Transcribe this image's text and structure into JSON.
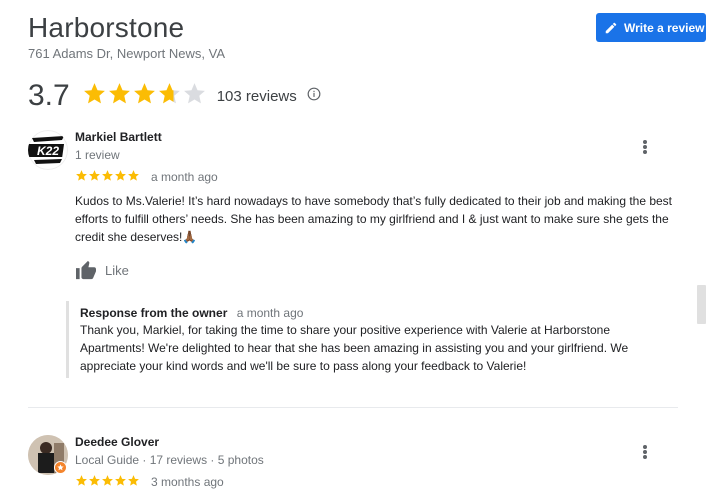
{
  "place": {
    "name": "Harborstone",
    "address": "761 Adams Dr, Newport News, VA",
    "rating": "3.7",
    "rating_value": 3.7,
    "review_count": "103 reviews"
  },
  "actions": {
    "write_review": "Write a review"
  },
  "colors": {
    "accent": "#1a73e8",
    "star": "#fbbc04",
    "star_empty": "#dadce0"
  },
  "reviews": [
    {
      "author": "Markiel Bartlett",
      "meta": "1 review",
      "avatar_text": "K22",
      "stars": 5,
      "when": "a month ago",
      "text": "Kudos to Ms.Valerie! It’s hard nowadays to have somebody that’s fully dedicated to their job and making the best efforts to fulfill others’ needs. She has been amazing to my girlfriend and I & just want to make sure she gets the credit she deserves!🙏🏾",
      "like_label": "Like",
      "response": {
        "title": "Response from the owner",
        "when": "a month ago",
        "text": "Thank you, Markiel, for taking the time to share your positive experience with Valerie at Harborstone Apartments! We're delighted to hear that she has been amazing in assisting you and your girlfriend. We appreciate your kind words and we'll be sure to pass along your feedback to Valerie!"
      }
    },
    {
      "author": "Deedee Glover",
      "meta": "Local Guide · 17 reviews · 5 photos",
      "stars": 5,
      "when": "3 months ago"
    }
  ]
}
